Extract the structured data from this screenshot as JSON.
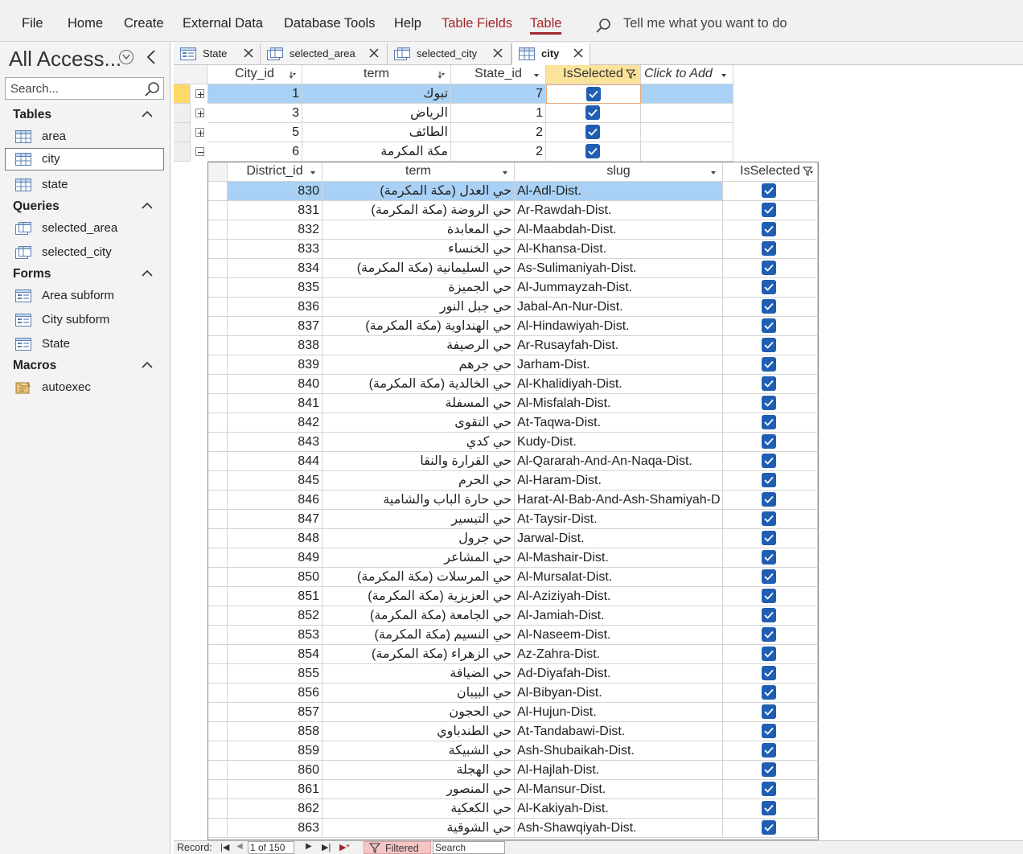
{
  "menu": {
    "items": [
      "File",
      "Home",
      "Create",
      "External Data",
      "Database Tools",
      "Help"
    ],
    "contextual": [
      "Table Fields",
      "Table"
    ],
    "tell_me": "Tell me what you want to do"
  },
  "nav": {
    "title": "All Access...",
    "search_placeholder": "Search...",
    "groups": [
      {
        "label": "Tables",
        "items": [
          "area",
          "city",
          "state"
        ]
      },
      {
        "label": "Queries",
        "items": [
          "selected_area",
          "selected_city"
        ]
      },
      {
        "label": "Forms",
        "items": [
          "Area subform",
          "City subform",
          "State"
        ]
      },
      {
        "label": "Macros",
        "items": [
          "autoexec"
        ]
      }
    ],
    "selected_item": "city"
  },
  "tabs": [
    {
      "label": "State",
      "icon": "form-icon"
    },
    {
      "label": "selected_area",
      "icon": "query-icon"
    },
    {
      "label": "selected_city",
      "icon": "query-icon"
    },
    {
      "label": "city",
      "icon": "table-icon",
      "active": true
    }
  ],
  "city_table": {
    "columns": [
      "City_id",
      "term",
      "State_id",
      "IsSelected",
      "Click to Add"
    ],
    "rows": [
      {
        "City_id": "1",
        "term": "تبوك",
        "State_id": "7",
        "IsSelected": true
      },
      {
        "City_id": "3",
        "term": "الرياض",
        "State_id": "1",
        "IsSelected": true
      },
      {
        "City_id": "5",
        "term": "الطائف",
        "State_id": "2",
        "IsSelected": true
      },
      {
        "City_id": "6",
        "term": "مكة المكرمة",
        "State_id": "2",
        "IsSelected": true
      }
    ]
  },
  "subdatasheet": {
    "columns": [
      "District_id",
      "term",
      "slug",
      "IsSelected"
    ],
    "rows": [
      [
        "830",
        "حي العدل (مكة المكرمة)",
        "Al-Adl-Dist."
      ],
      [
        "831",
        "حي الروضة (مكة المكرمة)",
        "Ar-Rawdah-Dist."
      ],
      [
        "832",
        "حي المعابدة",
        "Al-Maabdah-Dist."
      ],
      [
        "833",
        "حي الخنساء",
        "Al-Khansa-Dist."
      ],
      [
        "834",
        "حي السليمانية (مكة المكرمة)",
        "As-Sulimaniyah-Dist."
      ],
      [
        "835",
        "حي الجميزة",
        "Al-Jummayzah-Dist."
      ],
      [
        "836",
        "حي جبل النور",
        "Jabal-An-Nur-Dist."
      ],
      [
        "837",
        "حي الهنداوية (مكة المكرمة)",
        "Al-Hindawiyah-Dist."
      ],
      [
        "838",
        "حي الرصيفة",
        "Ar-Rusayfah-Dist."
      ],
      [
        "839",
        "حي جرهم",
        "Jarham-Dist."
      ],
      [
        "840",
        "حي الخالدية (مكة المكرمة)",
        "Al-Khalidiyah-Dist."
      ],
      [
        "841",
        "حي المسفلة",
        "Al-Misfalah-Dist."
      ],
      [
        "842",
        "حي التقوى",
        "At-Taqwa-Dist."
      ],
      [
        "843",
        "حي كدي",
        "Kudy-Dist."
      ],
      [
        "844",
        "حي القرارة والنقا",
        "Al-Qararah-And-An-Naqa-Dist."
      ],
      [
        "845",
        "حي الحرم",
        "Al-Haram-Dist."
      ],
      [
        "846",
        "حي حارة الباب والشامية",
        "Harat-Al-Bab-And-Ash-Shamiyah-D"
      ],
      [
        "847",
        "حي التيسير",
        "At-Taysir-Dist."
      ],
      [
        "848",
        "حي جرول",
        "Jarwal-Dist."
      ],
      [
        "849",
        "حي المشاعر",
        "Al-Mashair-Dist."
      ],
      [
        "850",
        "حي المرسلات (مكة المكرمة)",
        "Al-Mursalat-Dist."
      ],
      [
        "851",
        "حي العزيزية (مكة المكرمة)",
        "Al-Aziziyah-Dist."
      ],
      [
        "852",
        "حي الجامعة (مكة المكرمة)",
        "Al-Jamiah-Dist."
      ],
      [
        "853",
        "حي النسيم (مكة المكرمة)",
        "Al-Naseem-Dist."
      ],
      [
        "854",
        "حي الزهراء (مكة المكرمة)",
        "Az-Zahra-Dist."
      ],
      [
        "855",
        "حي الضيافة",
        "Ad-Diyafah-Dist."
      ],
      [
        "856",
        "حي البيبان",
        "Al-Bibyan-Dist."
      ],
      [
        "857",
        "حي الحجون",
        "Al-Hujun-Dist."
      ],
      [
        "858",
        "حي الطندباوي",
        "At-Tandabawi-Dist."
      ],
      [
        "859",
        "حي الشبيكة",
        "Ash-Shubaikah-Dist."
      ],
      [
        "860",
        "حي الهجلة",
        "Al-Hajlah-Dist."
      ],
      [
        "861",
        "حي المنصور",
        "Al-Mansur-Dist."
      ],
      [
        "862",
        "حي الكعكية",
        "Al-Kakiyah-Dist."
      ],
      [
        "863",
        "حي الشوقية",
        "Ash-Shawqiyah-Dist."
      ]
    ]
  },
  "status": {
    "record_label": "Record:",
    "record_value": "1 of 150",
    "filtered": "Filtered",
    "search_placeholder": "Search"
  },
  "colors": {
    "accent": "#a4262c",
    "selected_row": "#a9d1f5",
    "checkbox": "#1f5eb3"
  }
}
